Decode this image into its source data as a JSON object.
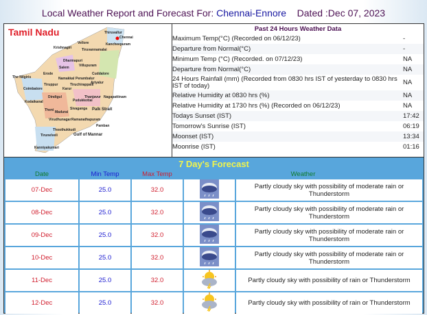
{
  "header": {
    "prefix": "Local Weather Report and Forecast For: ",
    "station": "Chennai-Ennore",
    "dated": "Dated :Dec 07, 2023"
  },
  "map": {
    "title": "Tamil Nadu",
    "labels": [
      "Thiruvallur",
      "Chennai",
      "Vellore",
      "Kancheepuram",
      "Krishnagiri",
      "Tiruvannamalai",
      "Dharmapuri",
      "Villupuram",
      "Salem",
      "Cuddalore",
      "Erode",
      "The Nilgiris",
      "Namakkal",
      "Perambalur",
      "Ariyalur",
      "Coimbatore",
      "Tiruppur",
      "Karur",
      "Tiruchirappalli",
      "Thanjavur",
      "Nagapattinam",
      "Kodaikanal",
      "Dindigul",
      "Pudukkottai",
      "Theni",
      "Madurai",
      "Sivaganga",
      "Palk Strait",
      "Virudhunagar",
      "Ramanathapuram",
      "Pamban",
      "Thoothukkudi",
      "Tirunelveli",
      "Gulf of Mannar",
      "Kanniyakumari"
    ]
  },
  "past24": {
    "title": "Past 24 Hours Weather Data",
    "rows": [
      {
        "label": "Maximum Temp(°C) (Recorded on 06/12/23)",
        "value": "-"
      },
      {
        "label": "Departure from Normal(°C)",
        "value": "-"
      },
      {
        "label": "Minimum Temp (°C) (Recorded. on 07/12/23)",
        "value": "NA"
      },
      {
        "label": "Departure from Normal(°C)",
        "value": "NA"
      },
      {
        "label": "24 Hours Rainfall (mm) (Recorded from 0830 hrs IST of yesterday to 0830 hrs IST of today)",
        "value": "NA"
      },
      {
        "label": "Relative Humidity at 0830 hrs (%)",
        "value": "NA"
      },
      {
        "label": "Relative Humidity at 1730 hrs (%) (Recorded on 06/12/23)",
        "value": "NA"
      },
      {
        "label": "Todays Sunset (IST)",
        "value": "17:42"
      },
      {
        "label": "Tomorrow's Sunrise (IST)",
        "value": "06:19"
      },
      {
        "label": "Moonset (IST)",
        "value": "13:34"
      },
      {
        "label": "Moonrise (IST)",
        "value": "01:16"
      }
    ]
  },
  "forecast": {
    "title": "7 Day's Forecast",
    "columns": {
      "date": "Date",
      "min": "Min Temp",
      "max": "Max Temp",
      "weather": "Weather"
    },
    "rows": [
      {
        "date": "07-Dec",
        "min": "25.0",
        "max": "32.0",
        "icon": "rain-cloud-icon",
        "weather": "Partly cloudy sky with possibility of moderate rain or Thunderstorm"
      },
      {
        "date": "08-Dec",
        "min": "25.0",
        "max": "32.0",
        "icon": "rain-cloud-icon",
        "weather": "Partly cloudy sky with possibility of moderate rain or Thunderstorm"
      },
      {
        "date": "09-Dec",
        "min": "25.0",
        "max": "32.0",
        "icon": "rain-cloud-icon",
        "weather": "Partly cloudy sky with possibility of moderate rain or Thunderstorm"
      },
      {
        "date": "10-Dec",
        "min": "25.0",
        "max": "32.0",
        "icon": "rain-cloud-icon",
        "weather": "Partly cloudy sky with possibility of moderate rain or Thunderstorm"
      },
      {
        "date": "11-Dec",
        "min": "25.0",
        "max": "32.0",
        "icon": "sun-thunder-cloud-icon",
        "weather": "Partly cloudy sky with possibility of rain or Thunderstorm"
      },
      {
        "date": "12-Dec",
        "min": "25.0",
        "max": "32.0",
        "icon": "sun-thunder-cloud-icon",
        "weather": "Partly cloudy sky with possibility of rain or Thunderstorm"
      }
    ]
  }
}
